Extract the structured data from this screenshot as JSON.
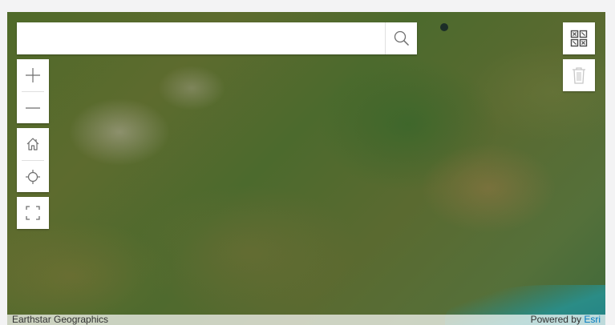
{
  "search": {
    "value": "",
    "placeholder": ""
  },
  "attribution": {
    "source": "Earthstar Geographics",
    "powered_by": "Powered by",
    "esri": "Esri"
  },
  "icons": {
    "search": "search-icon",
    "zoom_in": "plus-icon",
    "zoom_out": "minus-icon",
    "home": "home-icon",
    "locate": "crosshair-icon",
    "fullscreen": "fullscreen-icon",
    "sketch": "qr-grid-icon",
    "trash": "trash-icon"
  },
  "colors": {
    "link": "#0079c1",
    "panel": "#ffffff",
    "icon": "#6e6e6e"
  }
}
